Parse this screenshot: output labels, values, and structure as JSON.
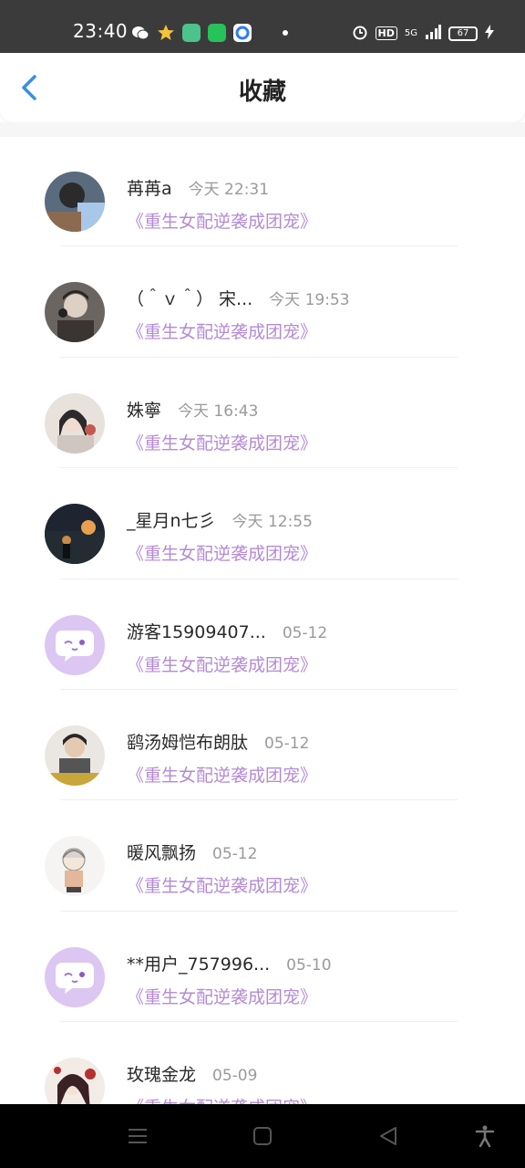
{
  "status_bar": {
    "time": "23:40",
    "left_icons": [
      "wechat-icon",
      "star-icon",
      "green-app-icon",
      "green-app-icon-2",
      "blue-app-icon"
    ],
    "network": "5G",
    "hd": "HD",
    "battery": "67"
  },
  "header": {
    "title": "收藏",
    "back_icon": "chevron-left-icon"
  },
  "colors": {
    "accent_blue": "#3a8ee6",
    "book_purple": "#b48ad6",
    "guest_avatar": "#dcc7f2"
  },
  "items": [
    {
      "name": "苒苒a",
      "time": "今天 22:31",
      "book": "《重生女配逆袭成团宠》",
      "avatar": "photo"
    },
    {
      "name": "（＾ｖ＾） 宋...",
      "time": "今天 19:53",
      "book": "《重生女配逆袭成团宠》",
      "avatar": "photo"
    },
    {
      "name": "姝寧",
      "time": "今天 16:43",
      "book": "《重生女配逆袭成团宠》",
      "avatar": "photo"
    },
    {
      "name": "_星月n七彡",
      "time": "今天 12:55",
      "book": "《重生女配逆袭成团宠》",
      "avatar": "photo"
    },
    {
      "name": "游客15909407...",
      "time": "05-12",
      "book": "《重生女配逆袭成团宠》",
      "avatar": "guest"
    },
    {
      "name": "鹞汤姆恺布朗肽",
      "time": "05-12",
      "book": "《重生女配逆袭成团宠》",
      "avatar": "photo"
    },
    {
      "name": "暖风飘扬",
      "time": "05-12",
      "book": "《重生女配逆袭成团宠》",
      "avatar": "photo"
    },
    {
      "name": "**用户_757996...",
      "time": "05-10",
      "book": "《重生女配逆袭成团宠》",
      "avatar": "guest"
    },
    {
      "name": "玫瑰金龙",
      "time": "05-09",
      "book": "《重生女配逆袭成团宠》",
      "avatar": "photo"
    }
  ],
  "nav_bar": {
    "buttons": [
      "menu-icon",
      "home-icon",
      "back-triangle-icon",
      "accessibility-icon"
    ]
  }
}
